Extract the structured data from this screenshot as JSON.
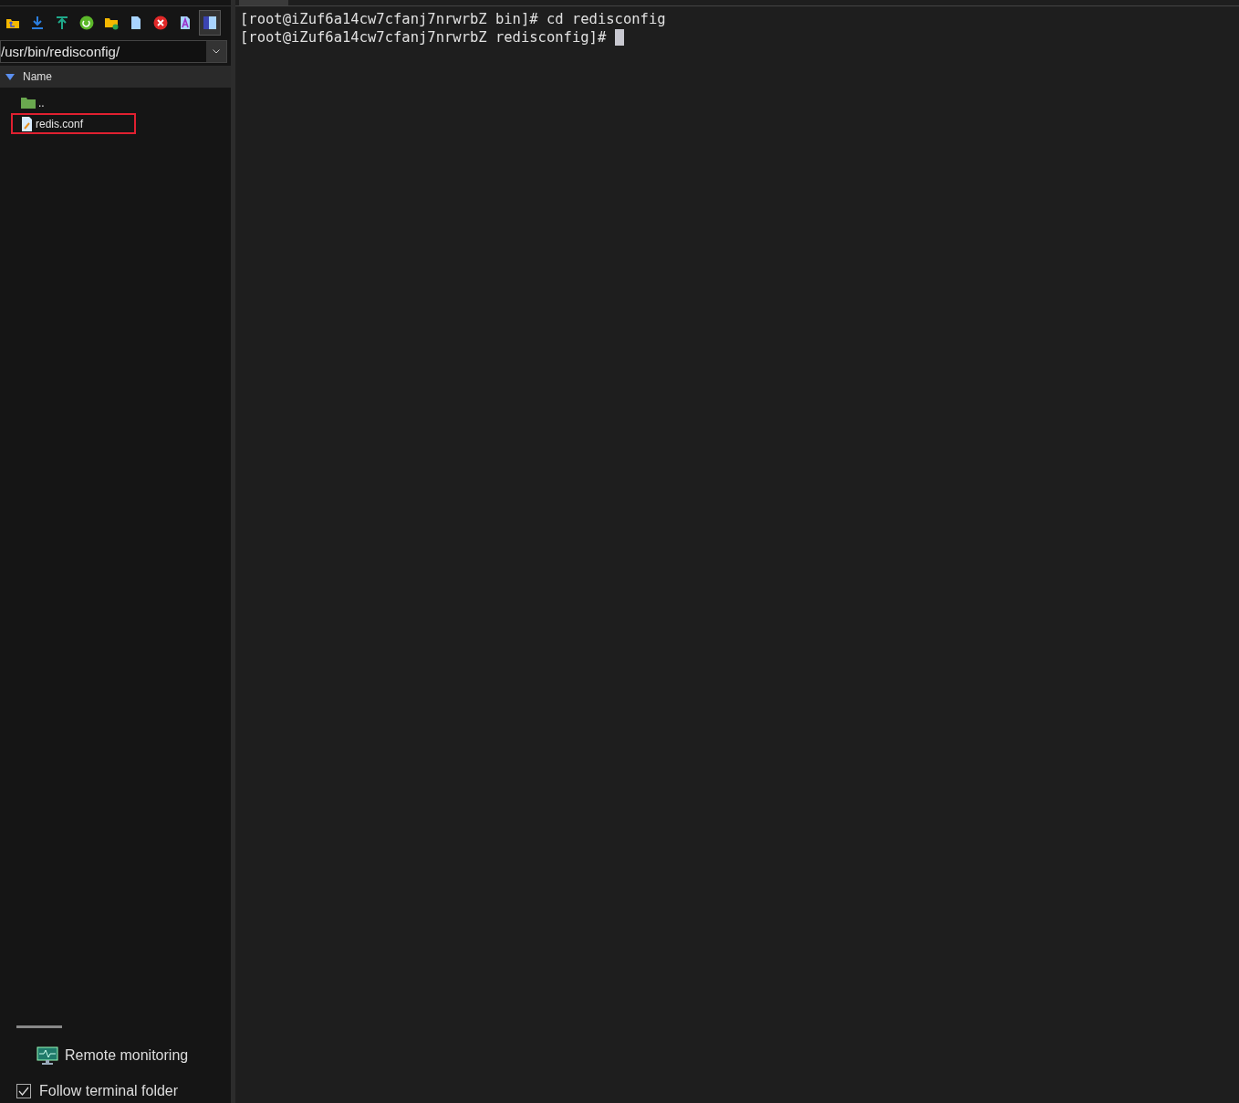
{
  "sidebar": {
    "toolbar": [
      {
        "kind": "folder-up"
      },
      {
        "kind": "download"
      },
      {
        "kind": "upload"
      },
      {
        "kind": "refresh"
      },
      {
        "kind": "new-folder"
      },
      {
        "kind": "new-file"
      },
      {
        "kind": "delete"
      },
      {
        "kind": "rename"
      },
      {
        "kind": "panel",
        "selected": true
      }
    ],
    "path": "/usr/bin/redisconfig/",
    "column": "Name",
    "files": [
      {
        "kind": "parent",
        "name": "..",
        "highlighted": false
      },
      {
        "kind": "file",
        "name": "redis.conf",
        "highlighted": true
      }
    ],
    "remote_monitoring": "Remote monitoring",
    "follow_folder": {
      "label": "Follow terminal folder",
      "checked": true
    }
  },
  "terminal": {
    "lines": [
      {
        "text": "[root@iZuf6a14cw7cfanj7nrwrbZ bin]# cd redisconfig",
        "cursor": false
      },
      {
        "text": "[root@iZuf6a14cw7cfanj7nrwrbZ redisconfig]# ",
        "cursor": true
      }
    ]
  }
}
